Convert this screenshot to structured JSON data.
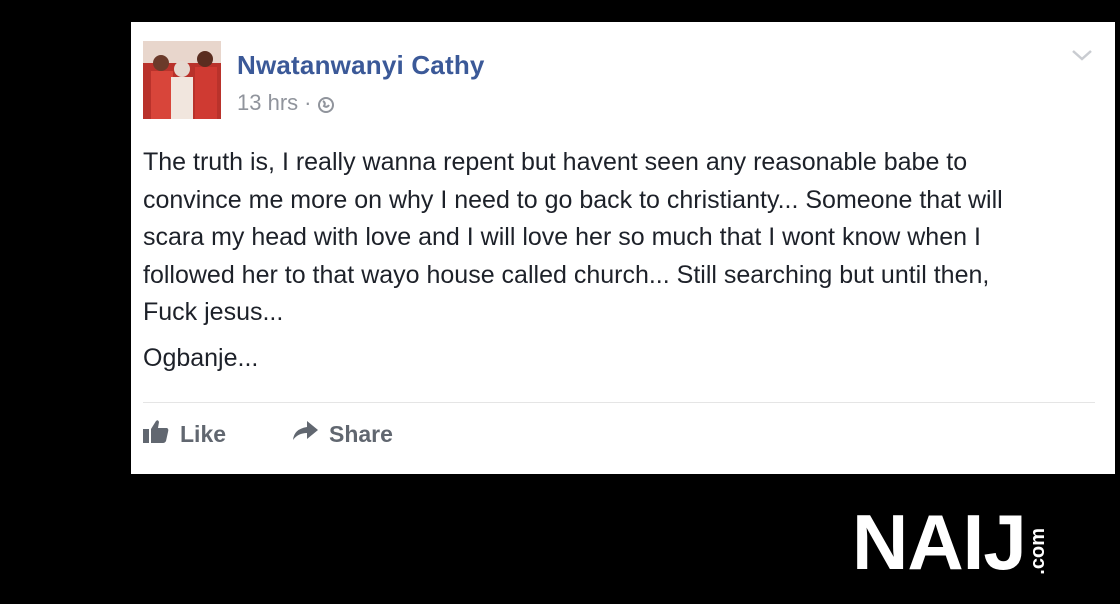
{
  "post": {
    "author_name": "Nwatanwanyi Cathy",
    "timestamp": "13 hrs",
    "separator": "·",
    "privacy_icon": "globe-icon",
    "body": "The truth is, I really wanna repent but havent seen any reasonable babe to\nconvince me more on why I need to go back to christianty... Someone that will\nscara my head with love and I will love her so much that I wont know when I\nfollowed her to that wayo house called church... Still searching but until then,\nFuck jesus...",
    "sign_off": "Ogbanje..."
  },
  "actions": {
    "like_label": "Like",
    "share_label": "Share"
  },
  "watermark": {
    "main": "NAIJ",
    "suffix": ".com"
  },
  "colors": {
    "author": "#3b5998",
    "meta": "#90949c",
    "action": "#616770",
    "background": "#000000"
  }
}
